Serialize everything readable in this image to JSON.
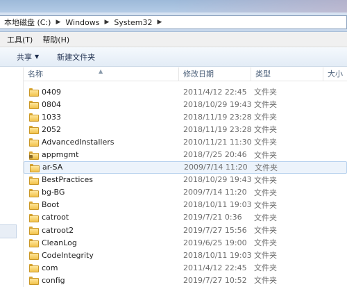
{
  "address": {
    "crumbs": [
      "本地磁盘 (C:)",
      "Windows",
      "System32"
    ]
  },
  "menu": {
    "tools": "工具(T)",
    "help": "帮助(H)"
  },
  "toolbar": {
    "share": "共享",
    "new_folder": "新建文件夹"
  },
  "columns": {
    "name": "名称",
    "modified": "修改日期",
    "type": "类型",
    "size": "大小"
  },
  "files": [
    {
      "name": "0409",
      "modified": "2011/4/12 22:45",
      "type": "文件夹"
    },
    {
      "name": "0804",
      "modified": "2018/10/29 19:43",
      "type": "文件夹"
    },
    {
      "name": "1033",
      "modified": "2018/11/19 23:28",
      "type": "文件夹"
    },
    {
      "name": "2052",
      "modified": "2018/11/19 23:28",
      "type": "文件夹"
    },
    {
      "name": "AdvancedInstallers",
      "modified": "2010/11/21 11:30",
      "type": "文件夹"
    },
    {
      "name": "appmgmt",
      "modified": "2018/7/25 20:46",
      "type": "文件夹"
    },
    {
      "name": "ar-SA",
      "modified": "2009/7/14 11:20",
      "type": "文件夹"
    },
    {
      "name": "BestPractices",
      "modified": "2018/10/29 19:43",
      "type": "文件夹"
    },
    {
      "name": "bg-BG",
      "modified": "2009/7/14 11:20",
      "type": "文件夹"
    },
    {
      "name": "Boot",
      "modified": "2018/10/11 19:03",
      "type": "文件夹"
    },
    {
      "name": "catroot",
      "modified": "2019/7/21 0:36",
      "type": "文件夹"
    },
    {
      "name": "catroot2",
      "modified": "2019/7/27 15:56",
      "type": "文件夹"
    },
    {
      "name": "CleanLog",
      "modified": "2019/6/25 19:00",
      "type": "文件夹"
    },
    {
      "name": "CodeIntegrity",
      "modified": "2018/10/11 19:03",
      "type": "文件夹"
    },
    {
      "name": "com",
      "modified": "2011/4/12 22:45",
      "type": "文件夹"
    },
    {
      "name": "config",
      "modified": "2019/7/27 10:52",
      "type": "文件夹"
    }
  ]
}
